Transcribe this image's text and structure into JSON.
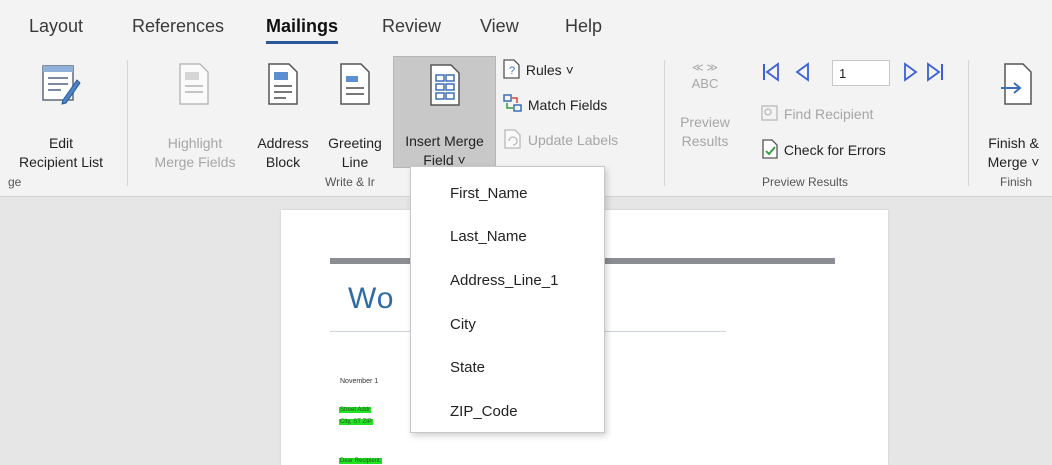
{
  "tabs": [
    "Layout",
    "References",
    "Mailings",
    "Review",
    "View",
    "Help"
  ],
  "buttons": {
    "edit_recipient": [
      "Edit",
      "Recipient List"
    ],
    "highlight": [
      "Highlight",
      "Merge Fields"
    ],
    "address_block": [
      "Address",
      "Block"
    ],
    "greeting_line": [
      "Greeting",
      "Line"
    ],
    "insert_merge_field": [
      "Insert Merge",
      "Field ˅"
    ],
    "rules": "Rules ˅",
    "match_fields": "Match Fields",
    "update_labels": "Update Labels",
    "preview_results": [
      "Preview",
      "Results"
    ],
    "abc_label": "ABC",
    "abc_arrows": "≪ ≫",
    "record_number": "1",
    "find_recipient": "Find Recipient",
    "check_errors": "Check for Errors",
    "finish_merge": [
      "Finish &",
      "Merge ˅"
    ]
  },
  "groups": {
    "start_mail_merge": "ge",
    "write_insert": "Write & Ir",
    "preview_results": "Preview Results",
    "finish": "Finish"
  },
  "dropdown": {
    "items": [
      "First_Name",
      "Last_Name",
      "Address_Line_1",
      "City",
      "State",
      "ZIP_Code"
    ]
  },
  "document": {
    "title_fragment": "Wo",
    "date": "November 1",
    "address_lines": [
      "Street Addr",
      "City, ST ZIP"
    ],
    "salutation": "Dear Recipient:"
  },
  "colors": {
    "accent": "#2b579a",
    "doc_title": "#2e6ca4",
    "highlight": "#21e321",
    "nav_arrows": "#3b5fd6"
  }
}
